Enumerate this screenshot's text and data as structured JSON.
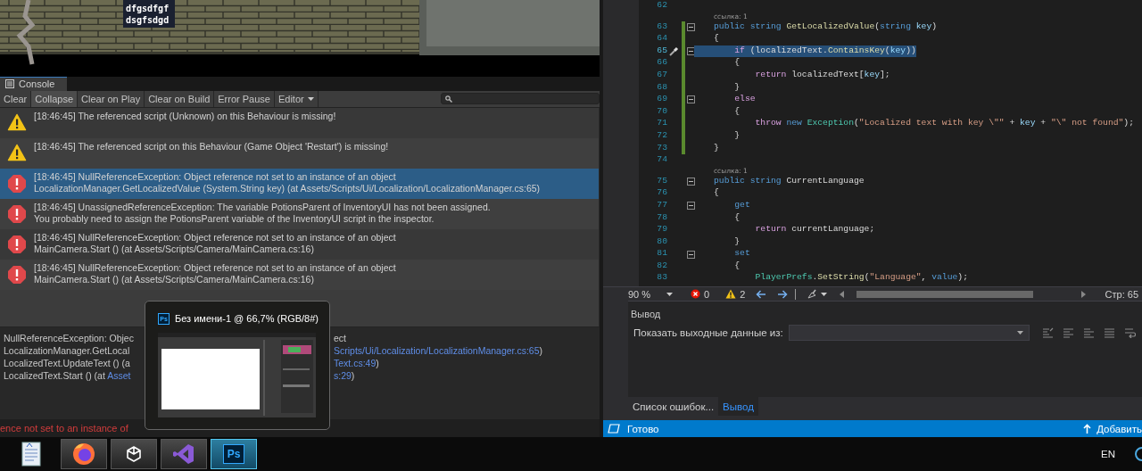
{
  "game_view": {
    "labels": [
      "dfgsdfgf",
      "dsgfsdgd"
    ]
  },
  "console": {
    "title": "Console",
    "toolbar": [
      {
        "label": "Clear",
        "on": false
      },
      {
        "label": "Collapse",
        "on": true
      },
      {
        "label": "Clear on Play",
        "on": false
      },
      {
        "label": "Clear on Build",
        "on": false
      },
      {
        "label": "Error Pause",
        "on": false
      }
    ],
    "dropdown": "Editor",
    "messages": [
      {
        "kind": "warning",
        "selected": false,
        "lines": [
          "[18:46:45] The referenced script (Unknown) on this Behaviour is missing!"
        ]
      },
      {
        "kind": "warning",
        "selected": false,
        "lines": [
          "[18:46:45] The referenced script on this Behaviour (Game Object 'Restart') is missing!"
        ]
      },
      {
        "kind": "error",
        "selected": true,
        "lines": [
          "[18:46:45] NullReferenceException: Object reference not set to an instance of an object",
          "LocalizationManager.GetLocalizedValue (System.String key) (at Assets/Scripts/Ui/Localization/LocalizationManager.cs:65)"
        ]
      },
      {
        "kind": "error",
        "selected": false,
        "lines": [
          "[18:46:45] UnassignedReferenceException: The variable PotionsParent of InventoryUI has not been assigned.",
          "You probably need to assign the PotionsParent variable of the InventoryUI script in the inspector."
        ]
      },
      {
        "kind": "error",
        "selected": false,
        "lines": [
          "[18:46:45] NullReferenceException: Object reference not set to an instance of an object",
          "MainCamera.Start () (at Assets/Scripts/Camera/MainCamera.cs:16)"
        ]
      },
      {
        "kind": "error",
        "selected": false,
        "lines": [
          "[18:46:45] NullReferenceException: Object reference not set to an instance of an object",
          "MainCamera.Start () (at Assets/Scripts/Camera/MainCamera.cs:16)"
        ]
      }
    ],
    "detail": [
      {
        "left": [
          {
            "text": "NullReferenceException: Objec",
            "kind": "plain"
          }
        ],
        "right": [
          {
            "text": "ect",
            "kind": "plain"
          }
        ]
      },
      {
        "left": [
          {
            "text": "LocalizationManager.GetLocal",
            "kind": "plain"
          }
        ],
        "right": [
          {
            "text": "Scripts/Ui/Localization/LocalizationManager.cs:65",
            "kind": "link"
          },
          {
            "text": ")",
            "kind": "plain"
          }
        ]
      },
      {
        "left": [
          {
            "text": "LocalizedText.UpdateText () (a",
            "kind": "plain"
          }
        ],
        "right": [
          {
            "text": "Text.cs:49",
            "kind": "link"
          },
          {
            "text": ")",
            "kind": "plain"
          }
        ]
      },
      {
        "left": [
          {
            "text": "LocalizedText.Start () (at ",
            "kind": "plain"
          },
          {
            "text": "Asset",
            "kind": "link"
          }
        ],
        "right": [
          {
            "text": "s:29",
            "kind": "link"
          },
          {
            "text": ")",
            "kind": "plain"
          }
        ]
      }
    ],
    "status": "ence not set to an instance of"
  },
  "editor": {
    "lines": [
      {
        "kind": "code",
        "number": "62",
        "changed": false,
        "selected": false,
        "fold": false
      },
      {
        "kind": "lens",
        "text": "ссылка: 1"
      },
      {
        "kind": "code",
        "number": "63",
        "changed": true,
        "selected": false,
        "fold": true,
        "tokens": [
          {
            "text": "public ",
            "kind": "kw"
          },
          {
            "text": "string ",
            "kind": "kw"
          },
          {
            "text": "GetLocalizedValue",
            "kind": "method"
          },
          {
            "text": "(",
            "kind": "plain"
          },
          {
            "text": "string ",
            "kind": "kw"
          },
          {
            "text": "key",
            "kind": "param"
          },
          {
            "text": ")",
            "kind": "plain"
          }
        ]
      },
      {
        "kind": "code",
        "number": "64",
        "changed": true,
        "selected": false,
        "fold": false,
        "tokens": [
          {
            "text": "{",
            "kind": "plain"
          }
        ]
      },
      {
        "kind": "code",
        "number": "65",
        "changed": true,
        "selected": true,
        "fold": true,
        "tokens": [
          {
            "text": "    if",
            "kind": "ctrl"
          },
          {
            "text": " (localizedText.",
            "kind": "plain"
          },
          {
            "text": "ContainsKey",
            "kind": "method"
          },
          {
            "text": "(",
            "kind": "plain"
          },
          {
            "text": "key",
            "kind": "param"
          },
          {
            "text": "))",
            "kind": "plain"
          }
        ]
      },
      {
        "kind": "code",
        "number": "66",
        "changed": true,
        "selected": false,
        "fold": false,
        "tokens": [
          {
            "text": "    {",
            "kind": "plain"
          }
        ]
      },
      {
        "kind": "code",
        "number": "67",
        "changed": true,
        "selected": false,
        "fold": false,
        "tokens": [
          {
            "text": "        return",
            "kind": "ctrl"
          },
          {
            "text": " localizedText[",
            "kind": "plain"
          },
          {
            "text": "key",
            "kind": "param"
          },
          {
            "text": "];",
            "kind": "plain"
          }
        ]
      },
      {
        "kind": "code",
        "number": "68",
        "changed": true,
        "selected": false,
        "fold": false,
        "tokens": [
          {
            "text": "    }",
            "kind": "plain"
          }
        ]
      },
      {
        "kind": "code",
        "number": "69",
        "changed": true,
        "selected": false,
        "fold": true,
        "tokens": [
          {
            "text": "    else",
            "kind": "ctrl"
          }
        ]
      },
      {
        "kind": "code",
        "number": "70",
        "changed": true,
        "selected": false,
        "fold": false,
        "tokens": [
          {
            "text": "    {",
            "kind": "plain"
          }
        ]
      },
      {
        "kind": "code",
        "number": "71",
        "changed": true,
        "selected": false,
        "fold": false,
        "tokens": [
          {
            "text": "        throw",
            "kind": "ctrl"
          },
          {
            "text": " new",
            "kind": "kw"
          },
          {
            "text": " Exception",
            "kind": "type"
          },
          {
            "text": "(",
            "kind": "plain"
          },
          {
            "text": "\"Localized text with key \\\"\"",
            "kind": "str"
          },
          {
            "text": " + ",
            "kind": "plain"
          },
          {
            "text": "key",
            "kind": "param"
          },
          {
            "text": " + ",
            "kind": "plain"
          },
          {
            "text": "\"\\\" not found\"",
            "kind": "str"
          },
          {
            "text": ");",
            "kind": "plain"
          }
        ]
      },
      {
        "kind": "code",
        "number": "72",
        "changed": true,
        "selected": false,
        "fold": false,
        "tokens": [
          {
            "text": "    }",
            "kind": "plain"
          }
        ]
      },
      {
        "kind": "code",
        "number": "73",
        "changed": true,
        "selected": false,
        "fold": false,
        "tokens": [
          {
            "text": "}",
            "kind": "plain"
          }
        ]
      },
      {
        "kind": "code",
        "number": "74",
        "changed": false,
        "selected": false,
        "fold": false
      },
      {
        "kind": "lens",
        "text": "ссылка: 1"
      },
      {
        "kind": "code",
        "number": "75",
        "changed": false,
        "selected": false,
        "fold": true,
        "tokens": [
          {
            "text": "public ",
            "kind": "kw"
          },
          {
            "text": "string ",
            "kind": "kw"
          },
          {
            "text": "CurrentLanguage",
            "kind": "plain"
          }
        ]
      },
      {
        "kind": "code",
        "number": "76",
        "changed": false,
        "selected": false,
        "fold": false,
        "tokens": [
          {
            "text": "{",
            "kind": "plain"
          }
        ]
      },
      {
        "kind": "code",
        "number": "77",
        "changed": false,
        "selected": false,
        "fold": true,
        "tokens": [
          {
            "text": "    get",
            "kind": "kw"
          }
        ]
      },
      {
        "kind": "code",
        "number": "78",
        "changed": false,
        "selected": false,
        "fold": false,
        "tokens": [
          {
            "text": "    {",
            "kind": "plain"
          }
        ]
      },
      {
        "kind": "code",
        "number": "79",
        "changed": false,
        "selected": false,
        "fold": false,
        "tokens": [
          {
            "text": "        return",
            "kind": "ctrl"
          },
          {
            "text": " currentLanguage;",
            "kind": "plain"
          }
        ]
      },
      {
        "kind": "code",
        "number": "80",
        "changed": false,
        "selected": false,
        "fold": false,
        "tokens": [
          {
            "text": "    }",
            "kind": "plain"
          }
        ]
      },
      {
        "kind": "code",
        "number": "81",
        "changed": false,
        "selected": false,
        "fold": true,
        "tokens": [
          {
            "text": "    set",
            "kind": "kw"
          }
        ]
      },
      {
        "kind": "code",
        "number": "82",
        "changed": false,
        "selected": false,
        "fold": false,
        "tokens": [
          {
            "text": "    {",
            "kind": "plain"
          }
        ]
      },
      {
        "kind": "code",
        "number": "83",
        "changed": false,
        "selected": false,
        "fold": false,
        "tokens": [
          {
            "text": "        PlayerPrefs",
            "kind": "type"
          },
          {
            "text": ".",
            "kind": "plain"
          },
          {
            "text": "SetString",
            "kind": "method"
          },
          {
            "text": "(",
            "kind": "plain"
          },
          {
            "text": "\"Language\"",
            "kind": "str"
          },
          {
            "text": ", ",
            "kind": "plain"
          },
          {
            "text": "value",
            "kind": "kw"
          },
          {
            "text": ");",
            "kind": "plain"
          }
        ]
      }
    ],
    "status": {
      "zoom": "90 %",
      "errors": "0",
      "warnings": "2",
      "position": "Стр: 65"
    }
  },
  "output": {
    "title": "Вывод",
    "source_label": "Показать выходные данные из:",
    "tabs": [
      {
        "label": "Список ошибок...",
        "selected": false
      },
      {
        "label": "Вывод",
        "selected": true
      }
    ]
  },
  "status_bar": {
    "text": "Готово",
    "action": "Добавить"
  },
  "taskbar": {
    "apps": [
      {
        "kind": "notepad",
        "open": false,
        "selected": false
      },
      {
        "kind": "firefox",
        "open": true,
        "selected": false
      },
      {
        "kind": "unity",
        "open": true,
        "selected": false
      },
      {
        "kind": "visual_studio",
        "open": true,
        "selected": false
      },
      {
        "kind": "photoshop",
        "open": true,
        "selected": true,
        "glyph": "Ps"
      }
    ],
    "language": "EN"
  },
  "preview": {
    "icon_text": "Ps",
    "title": "Без имени-1 @ 66,7% (RGB/8#)"
  }
}
